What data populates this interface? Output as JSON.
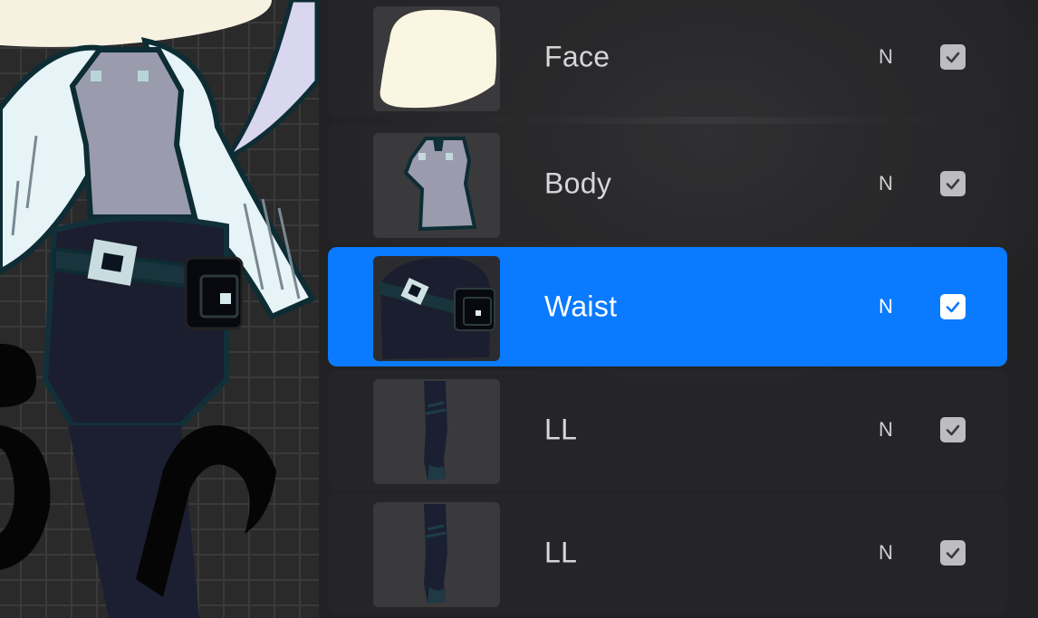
{
  "layers": [
    {
      "name": "Face",
      "blend_mode": "N",
      "visible": true,
      "selected": false,
      "thumbnail_icon": "face-thumbnail"
    },
    {
      "name": "Body",
      "blend_mode": "N",
      "visible": true,
      "selected": false,
      "thumbnail_icon": "body-thumbnail"
    },
    {
      "name": "Waist",
      "blend_mode": "N",
      "visible": true,
      "selected": true,
      "thumbnail_icon": "waist-thumbnail"
    },
    {
      "name": "LL",
      "blend_mode": "N",
      "visible": true,
      "selected": false,
      "thumbnail_icon": "leg-thumbnail"
    },
    {
      "name": "LL",
      "blend_mode": "N",
      "visible": true,
      "selected": false,
      "thumbnail_icon": "leg-thumbnail"
    }
  ],
  "colors": {
    "selected_accent": "#0a7aff",
    "panel_bg": "#222224",
    "canvas_grid": "#3a3a3b"
  }
}
